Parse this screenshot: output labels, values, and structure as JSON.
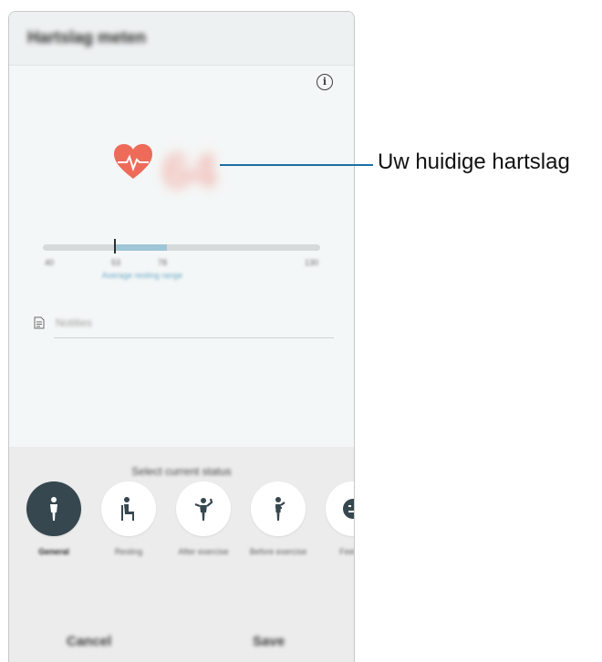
{
  "app": {
    "title": "Hartslag meten"
  },
  "measurement": {
    "bpm": "64"
  },
  "range": {
    "ticks": [
      "40",
      "53",
      "78",
      "130"
    ],
    "caption": "Average resting range"
  },
  "memo": {
    "placeholder": "Notities"
  },
  "status": {
    "title": "Select current status",
    "items": [
      {
        "label": "General",
        "icon": "person-standing-icon",
        "selected": true
      },
      {
        "label": "Resting",
        "icon": "person-sitting-icon",
        "selected": false
      },
      {
        "label": "After exercise",
        "icon": "person-flexing-icon",
        "selected": false
      },
      {
        "label": "Before exercise",
        "icon": "person-stretching-icon",
        "selected": false
      },
      {
        "label": "Feeling",
        "icon": "emoji-icon",
        "selected": false
      }
    ]
  },
  "actions": {
    "cancel": "Cancel",
    "save": "Save"
  },
  "callout": {
    "label": "Uw huidige hartslag"
  },
  "colors": {
    "heart": "#ee6b5a",
    "accent": "#1b6fa3",
    "selected": "#37474f"
  }
}
